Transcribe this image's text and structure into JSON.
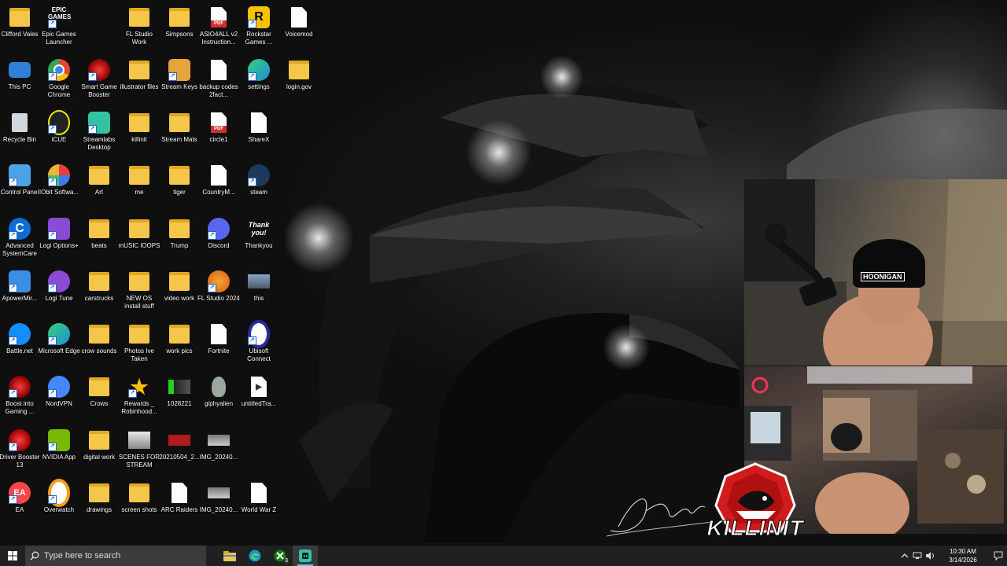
{
  "desktop": {
    "icons": [
      {
        "label": "Clifford Vales",
        "kind": "folder-user"
      },
      {
        "label": "Epic Games Launcher",
        "kind": "epic"
      },
      {
        "label": "FL Studio Work",
        "kind": "folder"
      },
      {
        "label": "Simpsons",
        "kind": "folder"
      },
      {
        "label": "ASIO4ALL v2 Instruction...",
        "kind": "pdf"
      },
      {
        "label": "Rockstar Games ...",
        "kind": "rockstar"
      },
      {
        "label": "Voicemod",
        "kind": "doc"
      },
      {
        "label": "This PC",
        "kind": "pc"
      },
      {
        "label": "Google Chrome",
        "kind": "chrome"
      },
      {
        "label": "Smart Game Booster",
        "kind": "booster"
      },
      {
        "label": "illustrator files",
        "kind": "folder"
      },
      {
        "label": "Stream Keys",
        "kind": "keys"
      },
      {
        "label": "backup codes 2fact...",
        "kind": "doc"
      },
      {
        "label": "settings",
        "kind": "edge"
      },
      {
        "label": "login.gov",
        "kind": "folder"
      },
      {
        "label": "Recycle Bin",
        "kind": "bin"
      },
      {
        "label": "iCUE",
        "kind": "icue"
      },
      {
        "label": "Streamlabs Desktop",
        "kind": "streamlabs"
      },
      {
        "label": "killinit",
        "kind": "folder"
      },
      {
        "label": "Stream Mats",
        "kind": "folder"
      },
      {
        "label": "circle1",
        "kind": "pdf"
      },
      {
        "label": "ShareX",
        "kind": "doc"
      },
      {
        "label": "Control Panel",
        "kind": "control"
      },
      {
        "label": "IObit Softwa...",
        "kind": "iobit"
      },
      {
        "label": "Art",
        "kind": "folder"
      },
      {
        "label": "me",
        "kind": "folder"
      },
      {
        "label": "tiger",
        "kind": "folder"
      },
      {
        "label": "CountryM...",
        "kind": "doc"
      },
      {
        "label": "steam",
        "kind": "steam"
      },
      {
        "label": "Advanced SystemCare",
        "kind": "asc"
      },
      {
        "label": "Logi Options+",
        "kind": "logi"
      },
      {
        "label": "beats",
        "kind": "folder"
      },
      {
        "label": "mUSIC lOOPS",
        "kind": "folder"
      },
      {
        "label": "Trump",
        "kind": "folder"
      },
      {
        "label": "Discord",
        "kind": "discord"
      },
      {
        "label": "Thankyou",
        "kind": "thankyou"
      },
      {
        "label": "ApowerMir...",
        "kind": "apower"
      },
      {
        "label": "Logi Tune",
        "kind": "logitune"
      },
      {
        "label": "carstrucks",
        "kind": "folder"
      },
      {
        "label": "NEW OS install stuff",
        "kind": "folder"
      },
      {
        "label": "video work",
        "kind": "folder"
      },
      {
        "label": "FL Studio 2024",
        "kind": "flstudio"
      },
      {
        "label": "this",
        "kind": "image"
      },
      {
        "label": "Battle.net",
        "kind": "battlenet"
      },
      {
        "label": "Microsoft Edge",
        "kind": "edge"
      },
      {
        "label": "crow sounds",
        "kind": "folder"
      },
      {
        "label": "Photos Ive Taken",
        "kind": "folder"
      },
      {
        "label": "work pics",
        "kind": "folder"
      },
      {
        "label": "Fortnite",
        "kind": "doc"
      },
      {
        "label": "Ubisoft Connect",
        "kind": "ubisoft"
      },
      {
        "label": "Boost into Gaming ...",
        "kind": "booster"
      },
      {
        "label": "NordVPN",
        "kind": "nordvpn"
      },
      {
        "label": "Crows",
        "kind": "folder"
      },
      {
        "label": "Rewards _ Robinhood...",
        "kind": "star"
      },
      {
        "label": "1028221",
        "kind": "greenbar"
      },
      {
        "label": "giphyalien",
        "kind": "alien"
      },
      {
        "label": "untitledTra...",
        "kind": "video"
      },
      {
        "label": "Driver Booster 13",
        "kind": "driver"
      },
      {
        "label": "NVIDIA App",
        "kind": "nvidia"
      },
      {
        "label": "digital work",
        "kind": "folder"
      },
      {
        "label": "SCENES FOR STREAM",
        "kind": "scenes"
      },
      {
        "label": "20210504_2...",
        "kind": "image-red"
      },
      {
        "label": "IMG_20240...",
        "kind": "image-car"
      },
      {
        "label": "EA",
        "kind": "ea"
      },
      {
        "label": "Overwatch",
        "kind": "overwatch"
      },
      {
        "label": "drawings",
        "kind": "folder"
      },
      {
        "label": "screen shots",
        "kind": "folder"
      },
      {
        "label": "ARC Raiders",
        "kind": "doc"
      },
      {
        "label": "IMG_20240...",
        "kind": "image-car"
      },
      {
        "label": "World War Z",
        "kind": "doc"
      }
    ]
  },
  "overlay": {
    "cap_text": "HOONIGAN",
    "logo_text": "KILLINIT"
  },
  "taskbar": {
    "search_placeholder": "Type here to search",
    "xbox_badge": "3",
    "time": "10:30 AM",
    "date": "3/14/2026"
  }
}
